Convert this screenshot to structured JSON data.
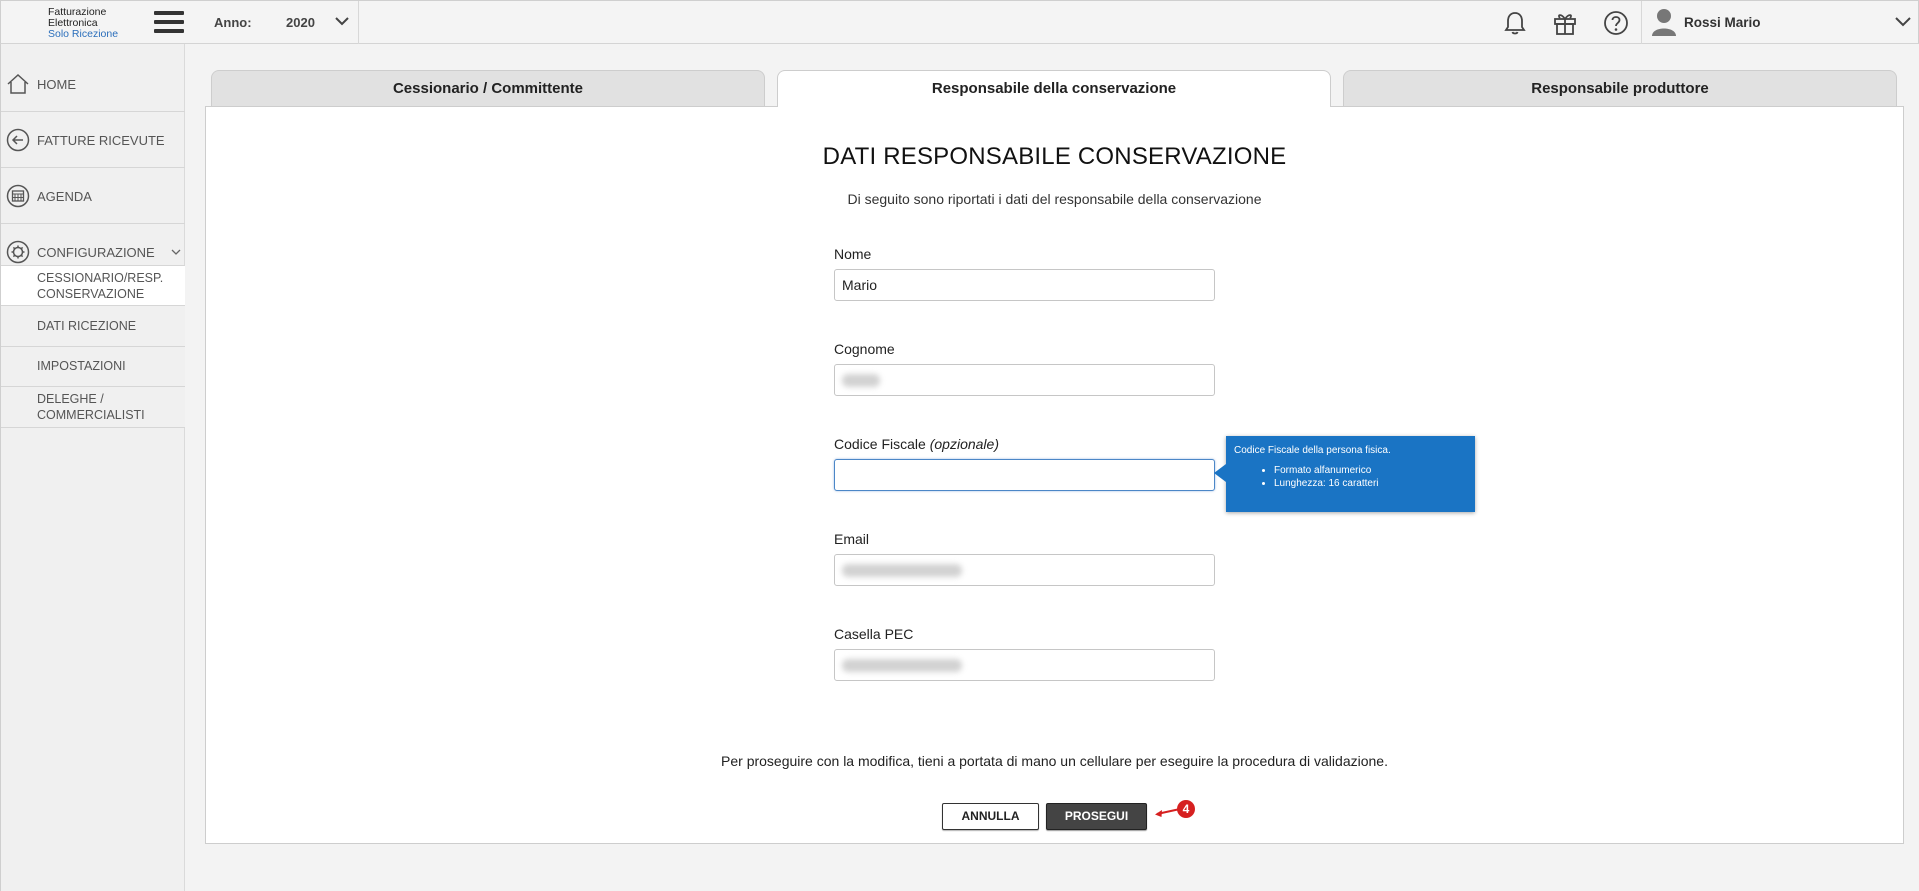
{
  "header": {
    "logo_lines": [
      "Fatturazione",
      "Elettronica",
      "Solo Ricezione"
    ],
    "year_label": "Anno:",
    "year_value": "2020",
    "user_name": "Rossi Mario",
    "icons": [
      "bell-icon",
      "gift-icon",
      "help-icon",
      "user-avatar-icon"
    ]
  },
  "sidebar": {
    "items": [
      {
        "label": "HOME",
        "icon": "home-icon"
      },
      {
        "label": "FATTURE RICEVUTE",
        "icon": "arrow-left-circle-icon"
      },
      {
        "label": "AGENDA",
        "icon": "calendar-icon"
      },
      {
        "label": "CONFIGURAZIONE",
        "icon": "gear-icon"
      }
    ],
    "subitems": [
      {
        "line1": "CESSIONARIO/RESP.",
        "line2": "CONSERVAZIONE",
        "active": true
      },
      {
        "line1": "DATI RICEZIONE",
        "line2": ""
      },
      {
        "line1": "IMPOSTAZIONI",
        "line2": ""
      },
      {
        "line1": "DELEGHE /",
        "line2": "COMMERCIALISTI"
      }
    ]
  },
  "tabs": [
    {
      "label": "Cessionario / Committente",
      "active": false
    },
    {
      "label": "Responsabile della conservazione",
      "active": true
    },
    {
      "label": "Responsabile produttore",
      "active": false
    }
  ],
  "form": {
    "title": "DATI RESPONSABILE CONSERVAZIONE",
    "subtitle": "Di seguito sono riportati i dati del responsabile della conservazione",
    "fields": {
      "nome": {
        "label": "Nome",
        "value": "Mario"
      },
      "cognome": {
        "label": "Cognome",
        "value": ""
      },
      "codice_fiscale": {
        "label": "Codice Fiscale",
        "label_suffix": "(opzionale)",
        "value": ""
      },
      "email": {
        "label": "Email",
        "value": ""
      },
      "pec": {
        "label": "Casella PEC",
        "value": ""
      }
    },
    "tooltip": {
      "title": "Codice Fiscale della persona fisica.",
      "bullets": [
        "Formato alfanumerico",
        "Lunghezza: 16 caratteri"
      ]
    },
    "notice": "Per proseguire con la modifica, tieni a portata di mano un cellulare per eseguire la procedura di validazione.",
    "cancel_label": "ANNULLA",
    "proceed_label": "PROSEGUI",
    "callout_number": "4"
  },
  "colors": {
    "tooltip_bg": "#1a74c4",
    "proceed_bg": "#444444",
    "callout": "#d62020"
  }
}
